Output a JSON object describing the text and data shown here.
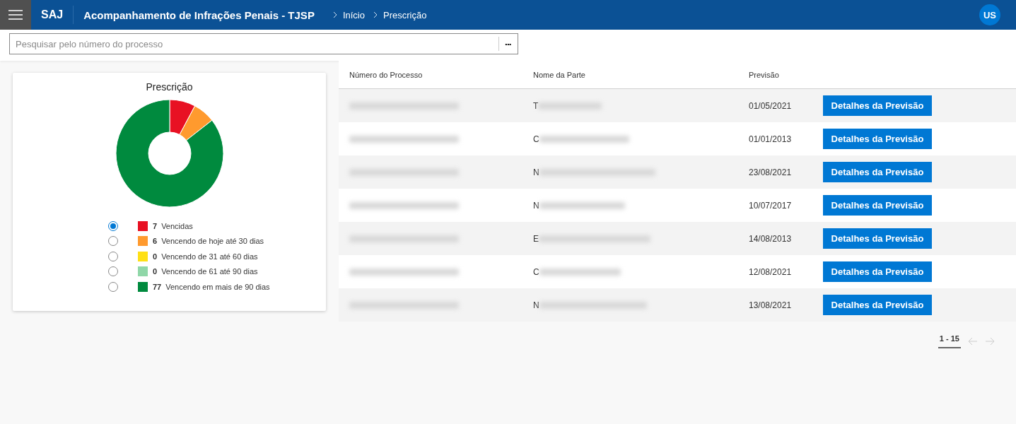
{
  "header": {
    "app": "SAJ",
    "title": "Acompanhamento de Infrações Penais - TJSP",
    "breadcrumbs": [
      "Início",
      "Prescrição"
    ],
    "avatar": "US"
  },
  "search": {
    "placeholder": "Pesquisar pelo número do processo",
    "more": "•••"
  },
  "summary": {
    "title": "Prescrição",
    "kind": "donut",
    "legend": [
      {
        "count": "7",
        "label": "Vencidas",
        "color": "#e81123",
        "selected": true
      },
      {
        "count": "6",
        "label": "Vencendo de hoje até 30 dias",
        "color": "#ff9a2e",
        "selected": false
      },
      {
        "count": "0",
        "label": "Vencendo de 31 até 60 dias",
        "color": "#ffe016",
        "selected": false
      },
      {
        "count": "0",
        "label": "Vencendo de 61 até 90 dias",
        "color": "#90d7a8",
        "selected": false
      },
      {
        "count": "77",
        "label": "Vencendo em mais de 90 dias",
        "color": "#008a3e",
        "selected": false
      }
    ]
  },
  "table": {
    "columns": [
      "Número do Processo",
      "Nome da Parte",
      "Previsão"
    ],
    "rows": [
      {
        "name_initial": "T",
        "date": "01/05/2021",
        "action": "Detalhes da Previsão"
      },
      {
        "name_initial": "C",
        "date": "01/01/2013",
        "action": "Detalhes da Previsão"
      },
      {
        "name_initial": "N",
        "date": "23/08/2021",
        "action": "Detalhes da Previsão"
      },
      {
        "name_initial": "N",
        "date": "10/07/2017",
        "action": "Detalhes da Previsão"
      },
      {
        "name_initial": "E",
        "date": "14/08/2013",
        "action": "Detalhes da Previsão"
      },
      {
        "name_initial": "C",
        "date": "12/08/2021",
        "action": "Detalhes da Previsão"
      },
      {
        "name_initial": "N",
        "date": "13/08/2021",
        "action": "Detalhes da Previsão"
      }
    ]
  },
  "pagination": {
    "range": "1 - 15"
  }
}
